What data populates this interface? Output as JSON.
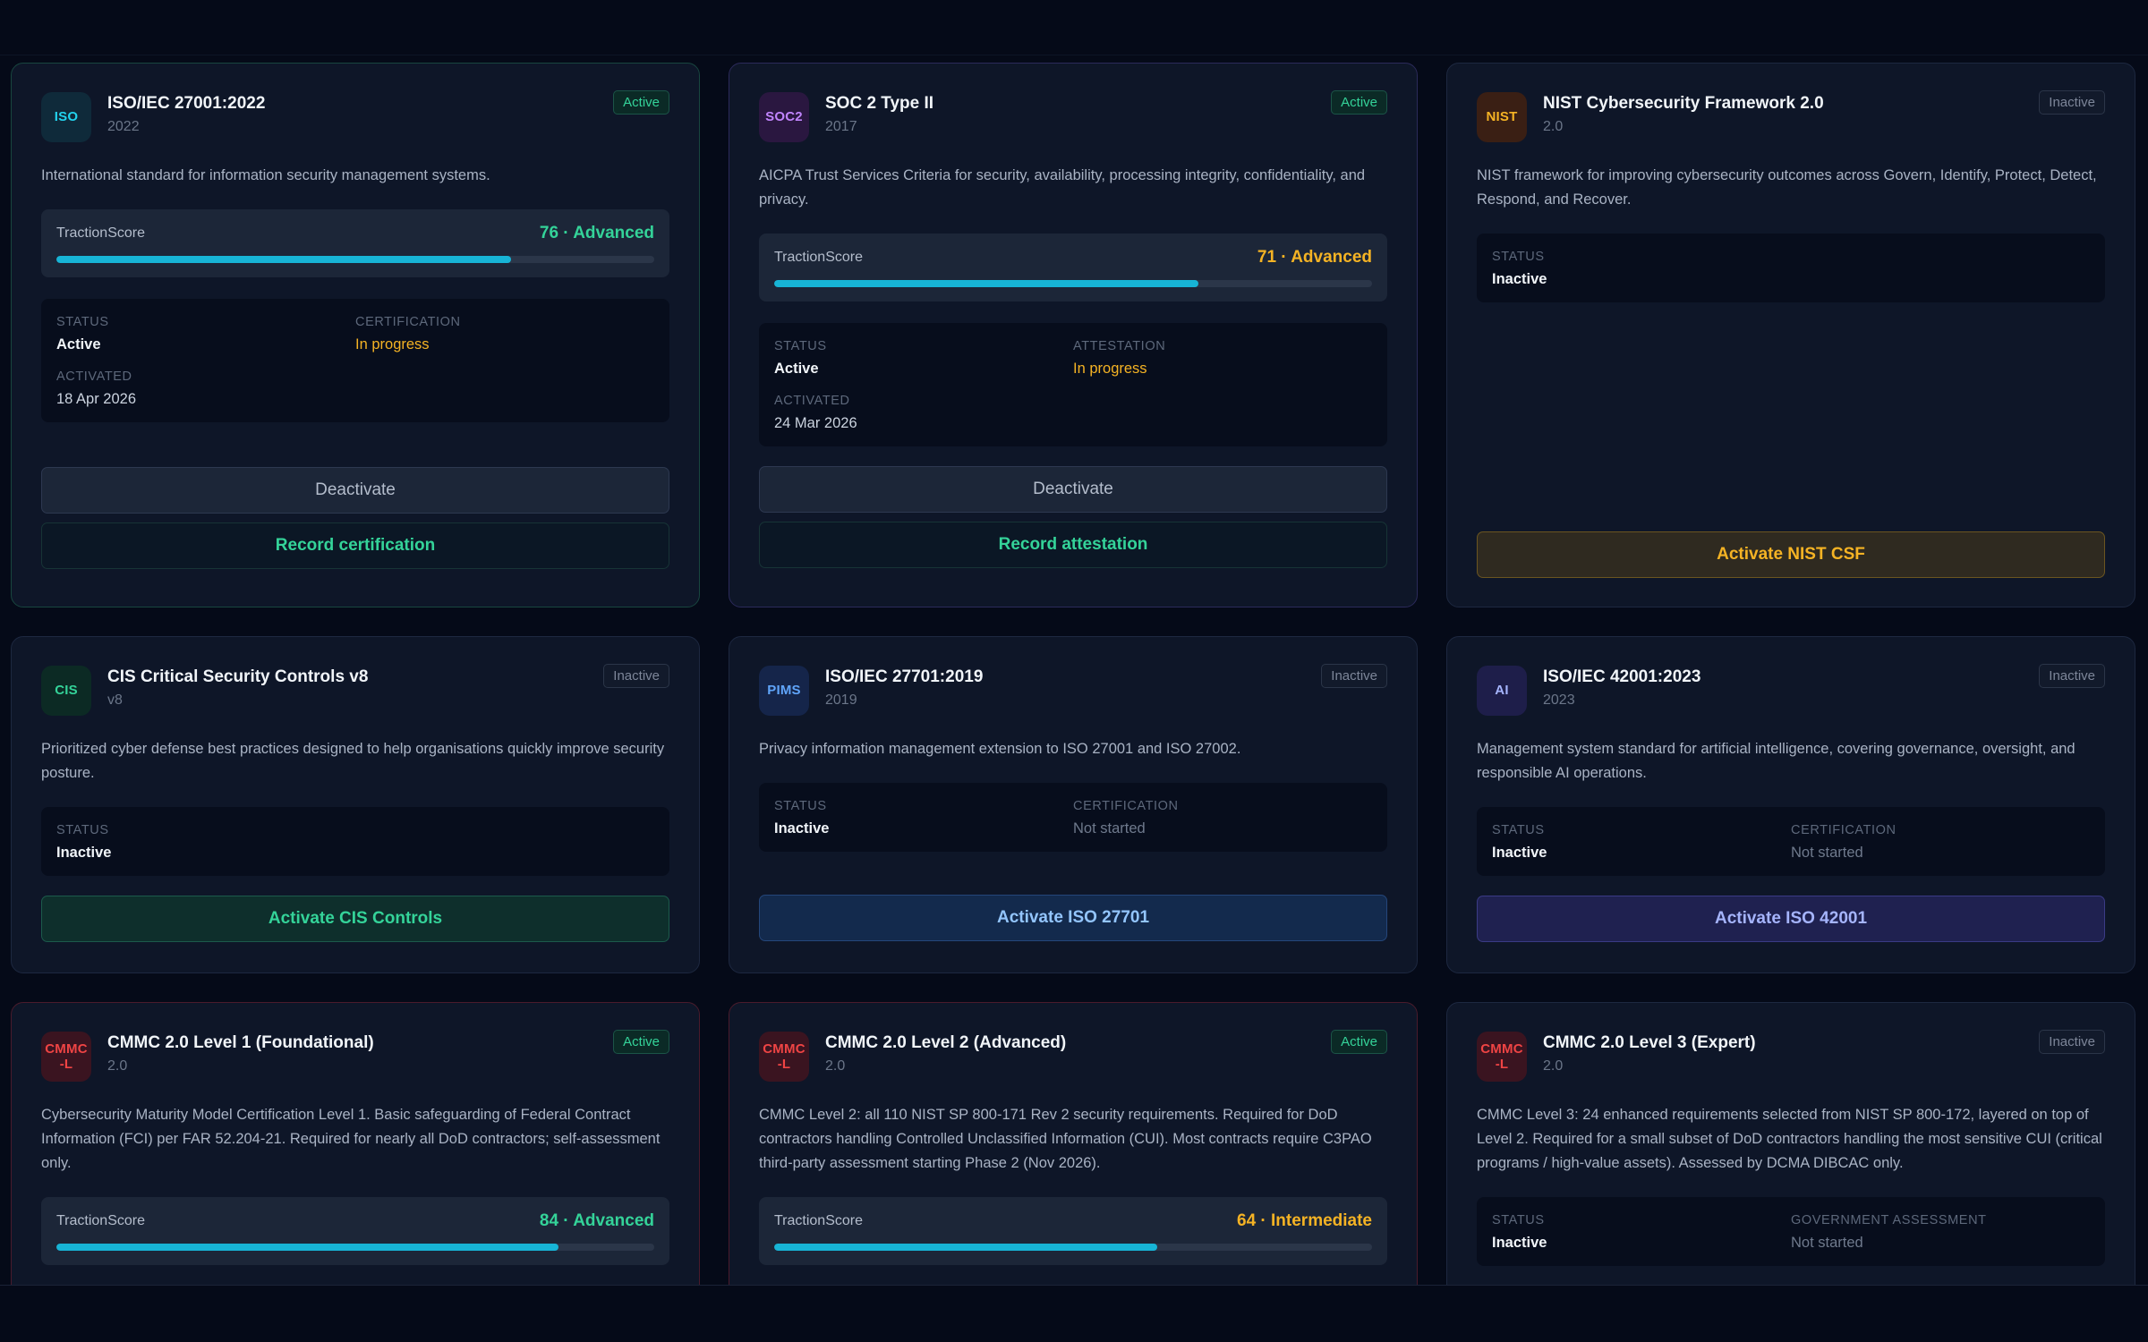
{
  "cards": [
    {
      "logo": "ISO",
      "title": "ISO/IEC 27001:2022",
      "version": "2022",
      "badge": "Active",
      "description": "International standard for information security management systems.",
      "score": {
        "label": "TractionScore",
        "value": "76 · Advanced",
        "percent": 76
      },
      "info": {
        "status_label": "STATUS",
        "status_value": "Active",
        "cert_label": "CERTIFICATION",
        "cert_value": "In progress",
        "activated_label": "ACTIVATED",
        "activated_value": "18 Apr 2026"
      },
      "deactivate_label": "Deactivate",
      "record_label": "Record certification"
    },
    {
      "logo": "SOC2",
      "title": "SOC 2 Type II",
      "version": "2017",
      "badge": "Active",
      "description": "AICPA Trust Services Criteria for security, availability, processing integrity, confidentiality, and privacy.",
      "score": {
        "label": "TractionScore",
        "value": "71 · Advanced",
        "percent": 71
      },
      "info": {
        "status_label": "STATUS",
        "status_value": "Active",
        "cert_label": "ATTESTATION",
        "cert_value": "In progress",
        "activated_label": "ACTIVATED",
        "activated_value": "24 Mar 2026"
      },
      "deactivate_label": "Deactivate",
      "record_label": "Record attestation"
    },
    {
      "logo": "NIST",
      "title": "NIST Cybersecurity Framework 2.0",
      "version": "2.0",
      "badge": "Inactive",
      "description": "NIST framework for improving cybersecurity outcomes across Govern, Identify, Protect, Detect, Respond, and Recover.",
      "info": {
        "status_label": "STATUS",
        "status_value": "Inactive"
      },
      "activate_label": "Activate NIST CSF"
    },
    {
      "logo": "CIS",
      "title": "CIS Critical Security Controls v8",
      "version": "v8",
      "badge": "Inactive",
      "description": "Prioritized cyber defense best practices designed to help organisations quickly improve security posture.",
      "info": {
        "status_label": "STATUS",
        "status_value": "Inactive"
      },
      "activate_label": "Activate CIS Controls"
    },
    {
      "logo": "PIMS",
      "title": "ISO/IEC 27701:2019",
      "version": "2019",
      "badge": "Inactive",
      "description": "Privacy information management extension to ISO 27001 and ISO 27002.",
      "info": {
        "status_label": "STATUS",
        "status_value": "Inactive",
        "cert_label": "CERTIFICATION",
        "cert_value": "Not started"
      },
      "activate_label": "Activate ISO 27701"
    },
    {
      "logo": "AI",
      "title": "ISO/IEC 42001:2023",
      "version": "2023",
      "badge": "Inactive",
      "description": "Management system standard for artificial intelligence, covering governance, oversight, and responsible AI operations.",
      "info": {
        "status_label": "STATUS",
        "status_value": "Inactive",
        "cert_label": "CERTIFICATION",
        "cert_value": "Not started"
      },
      "activate_label": "Activate ISO 42001"
    },
    {
      "logo": "CMMC-L",
      "title": "CMMC 2.0 Level 1 (Foundational)",
      "version": "2.0",
      "badge": "Active",
      "description": "Cybersecurity Maturity Model Certification Level 1. Basic safeguarding of Federal Contract Information (FCI) per FAR 52.204-21. Required for nearly all DoD contractors; self-assessment only.",
      "score": {
        "label": "TractionScore",
        "value": "84 · Advanced",
        "percent": 84
      }
    },
    {
      "logo": "CMMC-L",
      "title": "CMMC 2.0 Level 2 (Advanced)",
      "version": "2.0",
      "badge": "Active",
      "description": "CMMC Level 2: all 110 NIST SP 800-171 Rev 2 security requirements. Required for DoD contractors handling Controlled Unclassified Information (CUI). Most contracts require C3PAO third-party assessment starting Phase 2 (Nov 2026).",
      "score": {
        "label": "TractionScore",
        "value": "64 · Intermediate",
        "percent": 64
      }
    },
    {
      "logo": "CMMC-L",
      "title": "CMMC 2.0 Level 3 (Expert)",
      "version": "2.0",
      "badge": "Inactive",
      "description": "CMMC Level 3: 24 enhanced requirements selected from NIST SP 800-172, layered on top of Level 2. Required for a small subset of DoD contractors handling the most sensitive CUI (critical programs / high-value assets). Assessed by DCMA DIBCAC only.",
      "info": {
        "status_label": "STATUS",
        "status_value": "Inactive",
        "cert_label": "GOVERNMENT ASSESSMENT",
        "cert_value": "Not started"
      }
    }
  ],
  "colors": {
    "score_green": "#34d399",
    "score_amber": "#f5b324",
    "nist_accent": "#f5b324",
    "cis_accent": "#34d399",
    "pims_accent": "#60a5fa",
    "ai_accent": "#a5b4fc",
    "cmmc_accent": "#ef4444"
  }
}
